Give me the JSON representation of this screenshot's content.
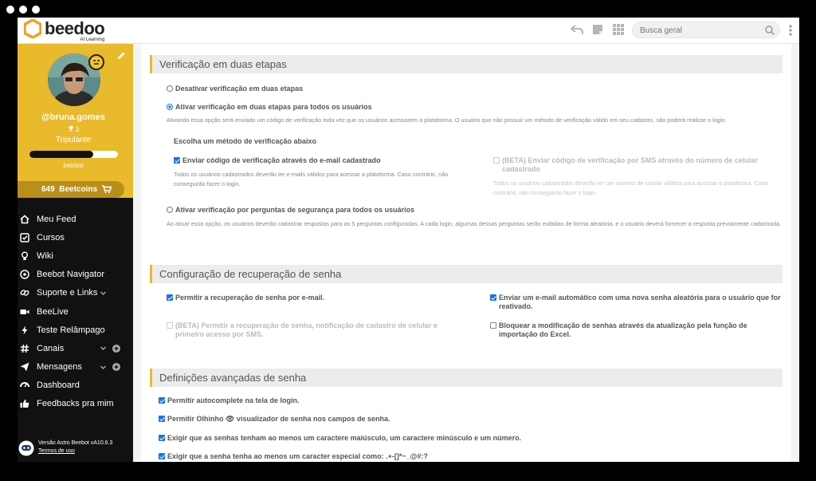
{
  "app": {
    "name": "beedoo",
    "subtitle": "AI Learning"
  },
  "search": {
    "placeholder": "Busca geral"
  },
  "profile": {
    "username": "@bruna.gomes",
    "trophies": "3",
    "rank": "Tripulante",
    "xp_text": "649/900",
    "xp_fraction": 0.72,
    "coins_amount": "649",
    "coins_label": "Beetcoins"
  },
  "nav": [
    {
      "label": "Meu Feed",
      "icon": "home-icon"
    },
    {
      "label": "Cursos",
      "icon": "checklist-icon"
    },
    {
      "label": "Wiki",
      "icon": "lightbulb-icon"
    },
    {
      "label": "Beebot Navigator",
      "icon": "compass-icon"
    },
    {
      "label": "Suporte e Links",
      "icon": "link-icon"
    },
    {
      "label": "BeeLive",
      "icon": "video-icon"
    },
    {
      "label": "Teste Relâmpago",
      "icon": "lightning-icon"
    },
    {
      "label": "Canais",
      "icon": "hashtag-icon"
    },
    {
      "label": "Mensagens",
      "icon": "send-icon"
    },
    {
      "label": "Dashboard",
      "icon": "dashboard-icon"
    },
    {
      "label": "Feedbacks pra mim",
      "icon": "thumbs-up-icon"
    }
  ],
  "footer": {
    "version": "Versão Astro Beebot vA10.6.3",
    "terms": "Termos de uso"
  },
  "two_step": {
    "title": "Verificação em duas etapas",
    "opt_disable": "Desativar verificação em duas etapas",
    "opt_enable_all": "Ativar verificação em duas etapas para todos os usuários",
    "enable_desc": "Ativando essa opção será enviado um código de verificação toda vez que os usuários acessarem a plataforma. O usuário que não possuir um método de verificação válido em seu cadastro, não poderá realizar o login.",
    "method_heading": "Escolha um método de verificação abaixo",
    "email_method": "Enviar código de verificação através do e-mail cadastrado",
    "email_desc": "Todos os usuários cadastrados deverão ter e-mails válidos para acessar a plataforma. Caso contrário, não conseguirão fazer o login.",
    "sms_method": "(BETA) Enviar código de verificação por SMS através do número de celular cadastrado",
    "sms_desc": "Todos os usuários cadastrados deverão ter um número de celular válidos para acessar a plataforma. Caso contrário, não conseguirão fazer o login.",
    "opt_questions": "Ativar verificação por perguntas de segurança para todos os usuários",
    "questions_desc": "Ao ativar essa opção, os usuários deverão cadastrar respostas para as 5 perguntas configuradas. A cada login, algumas dessas perguntas serão exibidas de forma aleatória, e o usuário deverá fornecer a resposta previamente cadastrada."
  },
  "recovery": {
    "title": "Configuração de recuperação de senha",
    "email_recovery": "Permitir a recuperação de senha por e-mail.",
    "auto_email": "Enviar um e-mail automático com uma nova senha aleatória para o usuário que for reativado.",
    "sms_recovery": "(BETA) Permitir a recuperação de senha, notificação de cadastro de celular e primeiro acesso por SMS.",
    "block_import": "Bloquear a modificação de senhas através da atualização pela função de importação do Excel."
  },
  "advanced": {
    "title": "Definições avançadas de senha",
    "autocomplete": "Permitir autocomplete na tela de login.",
    "eye_viewer": "Permitir Olhinho 👁 visualizador de senha nos campos de senha.",
    "case_number": "Exigir que as senhas tenham ao menos um caractere maiúsculo, um caractere minúsculo e um número.",
    "special_char": "Exigir que a senha tenha ao menos um caracter especial como: .+-[]*~_@#:?"
  }
}
